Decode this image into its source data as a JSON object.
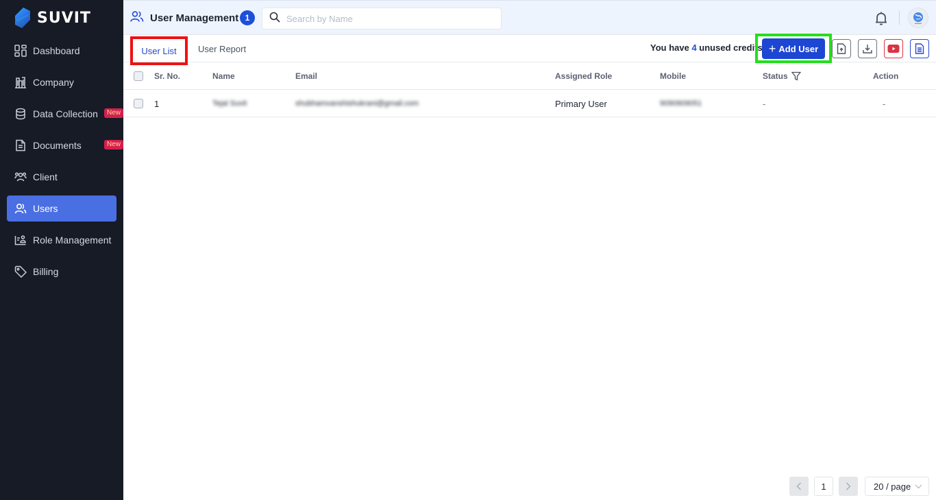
{
  "app": {
    "brand": "SUVIT"
  },
  "sidebar": {
    "items": [
      {
        "label": "Dashboard",
        "icon": "dashboard-grid-icon",
        "badge": null,
        "active": false
      },
      {
        "label": "Company",
        "icon": "buildings-icon",
        "badge": null,
        "active": false
      },
      {
        "label": "Data Collection",
        "icon": "database-icon",
        "badge": "New",
        "active": false
      },
      {
        "label": "Documents",
        "icon": "document-icon",
        "badge": "New",
        "active": false
      },
      {
        "label": "Client",
        "icon": "client-group-icon",
        "badge": null,
        "active": false
      },
      {
        "label": "Users",
        "icon": "users-icon",
        "badge": null,
        "active": true
      },
      {
        "label": "Role Management",
        "icon": "role-card-icon",
        "badge": null,
        "active": false
      },
      {
        "label": "Billing",
        "icon": "tag-icon",
        "badge": null,
        "active": false
      }
    ]
  },
  "header": {
    "title": "User Management",
    "count": "1",
    "search_placeholder": "Search by Name",
    "search_value": ""
  },
  "tabs": [
    {
      "label": "User List",
      "active": true
    },
    {
      "label": "User Report",
      "active": false
    }
  ],
  "toolbar": {
    "credits_prefix": "You have ",
    "credits_count": "4",
    "credits_suffix": " unused credits",
    "add_user_label": "Add User",
    "icon_buttons": [
      "upload-file-icon",
      "download-icon",
      "youtube-icon",
      "document-list-icon"
    ],
    "colors": {
      "primary": "#1d46d3",
      "youtube": "#d93445",
      "highlight_red": "#ee1111",
      "highlight_green": "#22e01a"
    }
  },
  "table": {
    "columns": [
      "Sr. No.",
      "Name",
      "Email",
      "Assigned Role",
      "Mobile",
      "Status",
      "Action"
    ],
    "rows": [
      {
        "sr": "1",
        "name": "Tejal Suvit",
        "email": "shubhamvanshishukrani@gmail.com",
        "role": "Primary User",
        "mobile": "9090909051",
        "status": "-",
        "action": "-"
      }
    ]
  },
  "pagination": {
    "prev": "<",
    "current": "1",
    "next": ">",
    "page_size": "20 / page"
  }
}
